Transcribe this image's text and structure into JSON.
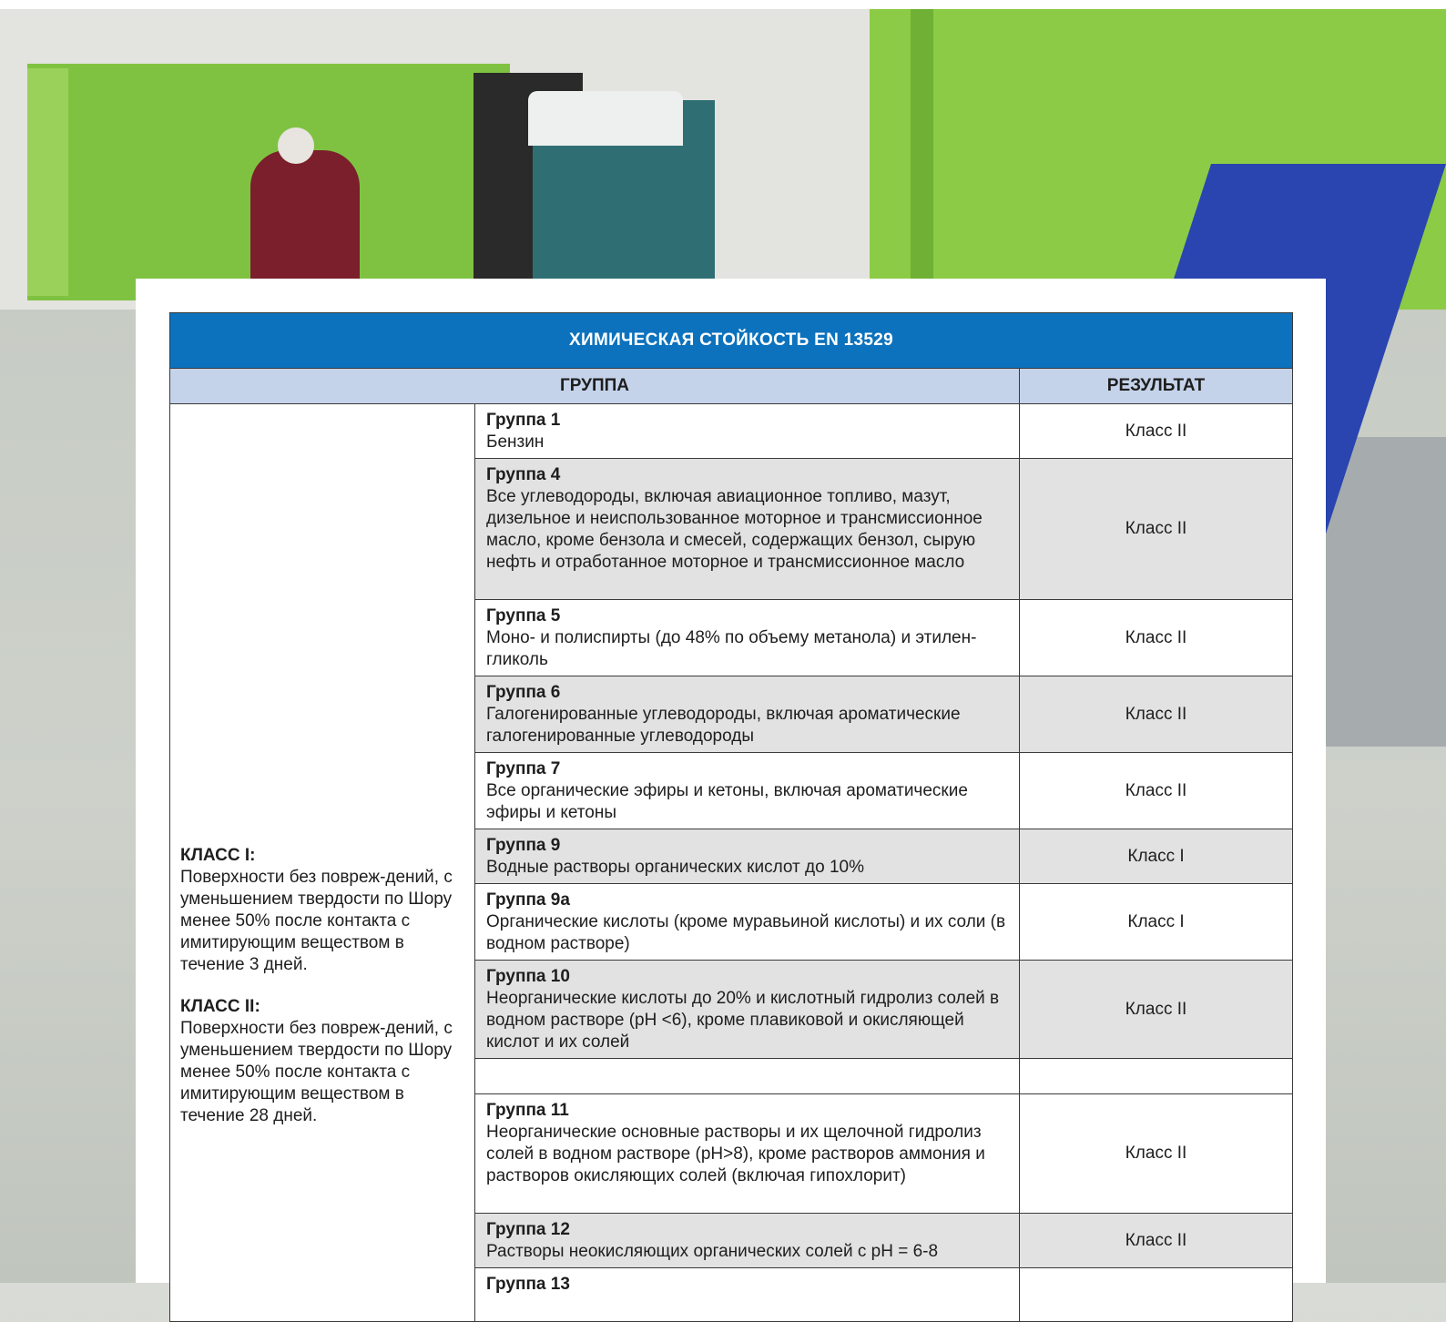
{
  "table": {
    "title": "ХИМИЧЕСКАЯ СТОЙКОСТЬ EN 13529",
    "col_group": "ГРУППА",
    "col_result": "РЕЗУЛЬТАТ",
    "class1_title": "КЛАСС I:",
    "class1_text": "Поверхности без повреж-дений, с уменьшением твердости по Шору менее 50% после контакта с имитирующим веществом в течение 3 дней.",
    "class2_title": "КЛАСС II:",
    "class2_text": "Поверхности без повреж-дений, с уменьшением твердости по Шору менее 50% после контакта с имитирующим веществом в течение 28 дней.",
    "rows": [
      {
        "group": "Группа 1",
        "desc": "Бензин",
        "result": "Класс II"
      },
      {
        "group": "Группа 4",
        "desc": "Все углеводороды, включая авиационное топливо, мазут, дизельное и неиспользованное моторное и трансмиссионное масло, кроме бензола и смесей, содержащих бензол, сырую нефть и отработанное моторное и трансмиссионное масло",
        "result": "Класс II"
      },
      {
        "group": "Группа 5",
        "desc": "Моно- и полиспирты (до 48% по объему метанола) и этилен-гликоль",
        "result": "Класс II"
      },
      {
        "group": "Группа 6",
        "desc": "Галогенированные углеводороды, включая ароматические галогенированные углеводороды",
        "result": "Класс II"
      },
      {
        "group": "Группа 7",
        "desc": "Все органические эфиры и кетоны, включая ароматические эфиры и кетоны",
        "result": "Класс II"
      },
      {
        "group": "Группа 9",
        "desc": "Водные растворы органических кислот до 10%",
        "result": "Класс I"
      },
      {
        "group": "Группа 9a",
        "desc": "Органические кислоты (кроме муравьиной кислоты) и их соли (в водном растворе)",
        "result": "Класс I"
      },
      {
        "group": "Группа 10",
        "desc": "Неорганические кислоты до 20% и кислотный гидролиз солей в водном растворе (pH <6), кроме плавиковой и окисляющей кислот и их солей",
        "result": "Класс II"
      },
      {
        "group": "Группа 11",
        "desc": "Неорганические основные растворы и их щелочной гидролиз солей в водном растворе (pH>8), кроме растворов аммония и растворов окисляющих солей (включая гипохлорит)",
        "result": "Класс II"
      },
      {
        "group": "Группа 12",
        "desc": "Растворы неокисляющих органических солей с pH = 6-8",
        "result": "Класс II"
      },
      {
        "group": "Группа 13",
        "desc": "",
        "result": ""
      }
    ]
  }
}
